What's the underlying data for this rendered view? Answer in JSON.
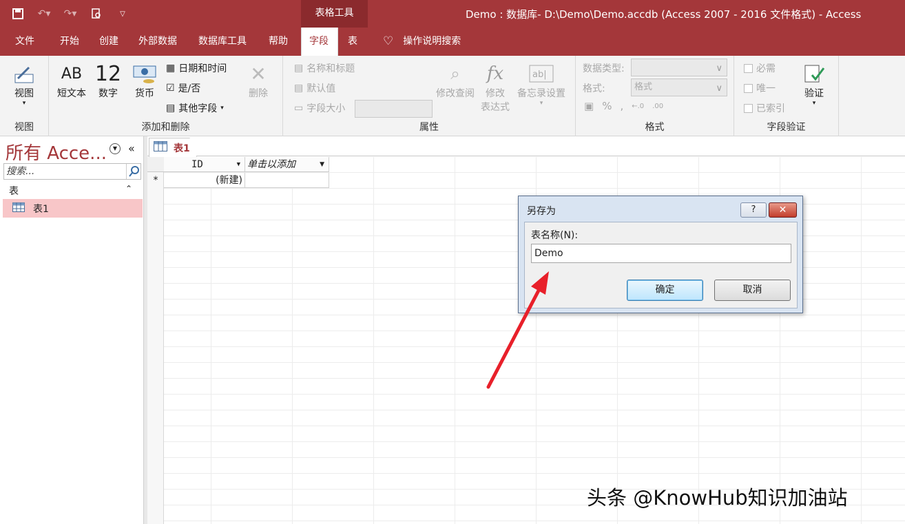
{
  "window": {
    "title": "Demo : 数据库- D:\\Demo\\Demo.accdb (Access 2007 - 2016 文件格式)  -  Access",
    "context_tab": "表格工具"
  },
  "tabs": [
    "文件",
    "开始",
    "创建",
    "外部数据",
    "数据库工具",
    "帮助",
    "字段",
    "表"
  ],
  "tell_me": "操作说明搜索",
  "ribbon": {
    "view_group": {
      "view_label": "视图",
      "group_label": "视图"
    },
    "add_delete_group": {
      "short_text": "短文本",
      "number": "数字",
      "currency": "货币",
      "date_time": "日期和时间",
      "yes_no": "是/否",
      "more_fields": "其他字段",
      "delete": "删除",
      "group_label": "添加和删除",
      "ab_glyph": "AB",
      "num_glyph": "12"
    },
    "properties_group": {
      "name_caption": "名称和标题",
      "default_value": "默认值",
      "field_size": "字段大小",
      "modify_lookups": "修改查阅",
      "modify_expression_1": "修改",
      "modify_expression_2": "表达式",
      "memo_settings": "备忘录设置",
      "group_label": "属性",
      "fx_glyph": "fx"
    },
    "format_group": {
      "data_type_label": "数据类型:",
      "format_label": "格式:",
      "format_placeholder": "格式",
      "group_label": "格式",
      "percent": "%",
      "comma": ","
    },
    "validation_group": {
      "required": "必需",
      "unique": "唯一",
      "indexed": "已索引",
      "validation": "验证",
      "group_label": "字段验证"
    }
  },
  "nav": {
    "title": "所有 Acce...",
    "search_placeholder": "搜索...",
    "section": "表",
    "items": [
      {
        "label": "表1"
      }
    ]
  },
  "doc_tab": "表1",
  "sheet": {
    "columns": [
      "ID",
      "单击以添加"
    ],
    "new_row_marker": "*",
    "new_row_value": "(新建)"
  },
  "dialog": {
    "title": "另存为",
    "help": "?",
    "close": "✕",
    "label": "表名称(N):",
    "input_value": "Demo",
    "ok": "确定",
    "cancel": "取消"
  },
  "watermark": "头条 @KnowHub知识加油站"
}
